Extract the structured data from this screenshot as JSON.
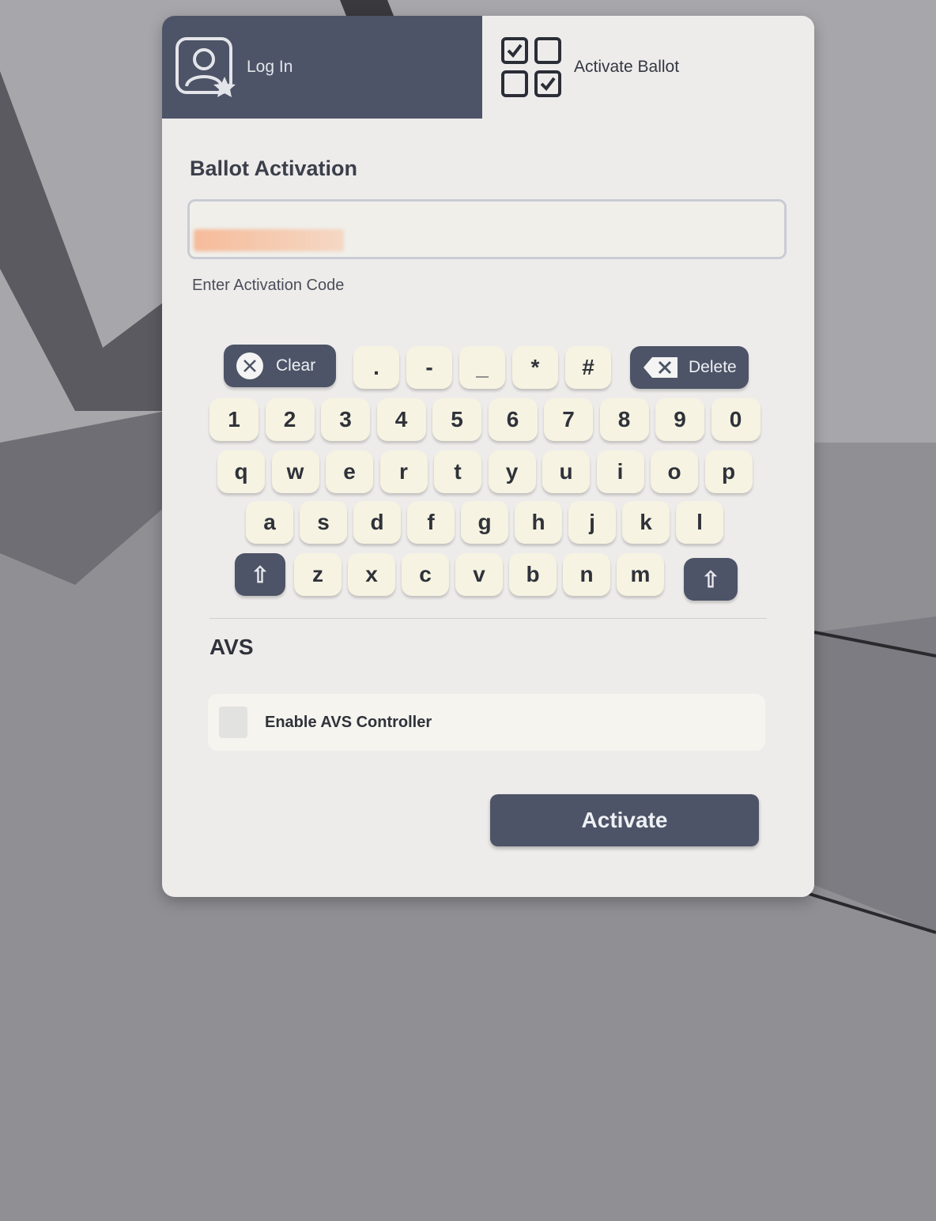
{
  "tabs": {
    "login_label": "Log In",
    "activate_label": "Activate Ballot"
  },
  "ballot": {
    "title": "Ballot Activation",
    "code_value": "",
    "hint": "Enter Activation Code"
  },
  "keyboard": {
    "clear_label": "Clear",
    "delete_label": "Delete",
    "symbols": [
      ".",
      "-",
      "_",
      "*",
      "#"
    ],
    "digits": [
      "1",
      "2",
      "3",
      "4",
      "5",
      "6",
      "7",
      "8",
      "9",
      "0"
    ],
    "row_q": [
      "q",
      "w",
      "e",
      "r",
      "t",
      "y",
      "u",
      "i",
      "o",
      "p"
    ],
    "row_a": [
      "a",
      "s",
      "d",
      "f",
      "g",
      "h",
      "j",
      "k",
      "l"
    ],
    "row_z": [
      "z",
      "x",
      "c",
      "v",
      "b",
      "n",
      "m"
    ],
    "shift_glyph": "⇧"
  },
  "avs": {
    "title": "AVS",
    "enable_label": "Enable AVS Controller",
    "enabled": false
  },
  "actions": {
    "activate_label": "Activate"
  },
  "colors": {
    "accent": "#4d5467",
    "key_face": "#f6f3e2",
    "panel": "#eeeceb"
  }
}
